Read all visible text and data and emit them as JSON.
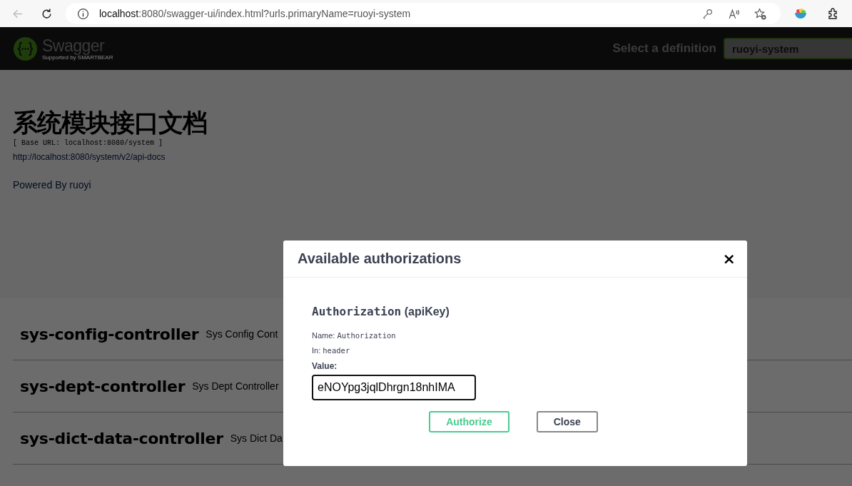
{
  "browser": {
    "url_host": "localhost",
    "url_rest": ":8080/swagger-ui/index.html?urls.primaryName=ruoyi-system"
  },
  "topbar": {
    "logo_text": "Swagger",
    "logo_sub": "Supported by SMARTBEAR",
    "definition_label": "Select a definition",
    "definition_value": "ruoyi-system"
  },
  "info": {
    "title": "系统模块接口文档",
    "base_url": "[ Base URL: localhost:8080/system ]",
    "docs_link": "http://localhost:8080/system/v2/api-docs",
    "powered_by": "Powered By ruoyi"
  },
  "tags": [
    {
      "name": "sys-config-controller",
      "description": "Sys Config Cont"
    },
    {
      "name": "sys-dept-controller",
      "description": "Sys Dept Controller"
    },
    {
      "name": "sys-dict-data-controller",
      "description": "Sys Dict Da"
    }
  ],
  "modal": {
    "title": "Available authorizations",
    "close": "×",
    "scheme_title": "Authorization",
    "scheme_type": "(apiKey)",
    "name_label": "Name:",
    "name_value": "Authorization",
    "in_label": "In:",
    "in_value": "header",
    "value_label": "Value:",
    "value": "eNOYpg3jqlDhrgn18nhIMA",
    "buttons": [
      {
        "kind": "authorize",
        "label": "Authorize"
      },
      {
        "kind": "close",
        "label": "Close"
      }
    ]
  }
}
